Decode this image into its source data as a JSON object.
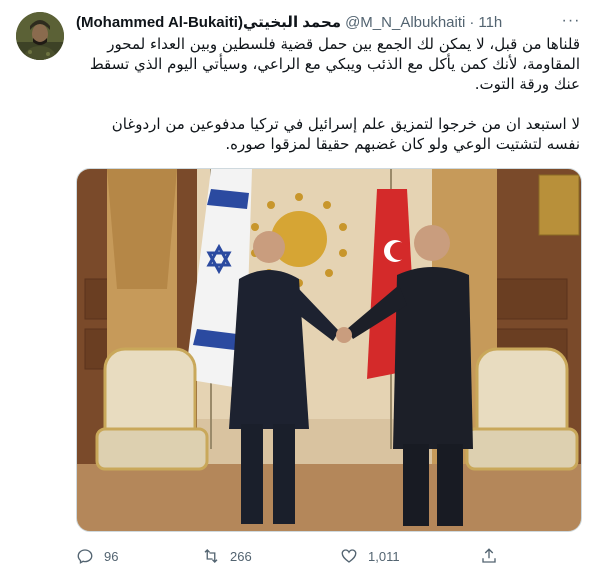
{
  "tweet": {
    "display_name": "(Mohammed Al-Bukaiti)محمد البخيتي",
    "handle": "@M_N_Albukhaiti",
    "separator": "·",
    "time": "11h",
    "more_label": "···",
    "paragraph1": "قلناها من قبل، لا يمكن لك الجمع بين حمل قضية فلسطين وبين العداء لمحور المقاومة، لأنك كمن يأكل مع الذئب ويبكي مع الراعي، وسيأتي اليوم الذي تسقط عنك ورقة التوت.",
    "paragraph2": "لا استبعد ان من خرجوا لتمزيق علم إسرائيل في تركيا مدفوعين من اردوغان نفسه لتشتيت الوعي ولو كان غضبهم حقيقا لمزقوا صوره."
  },
  "media": {
    "description_icon": "photo-of-two-men-shaking-hands-between-israeli-and-turkish-flags"
  },
  "actions": {
    "reply_count": "96",
    "retweet_count": "266",
    "like_count": "1,011"
  },
  "colors": {
    "text_primary": "#0f1419",
    "text_secondary": "#536471",
    "border": "#cfd9de"
  }
}
